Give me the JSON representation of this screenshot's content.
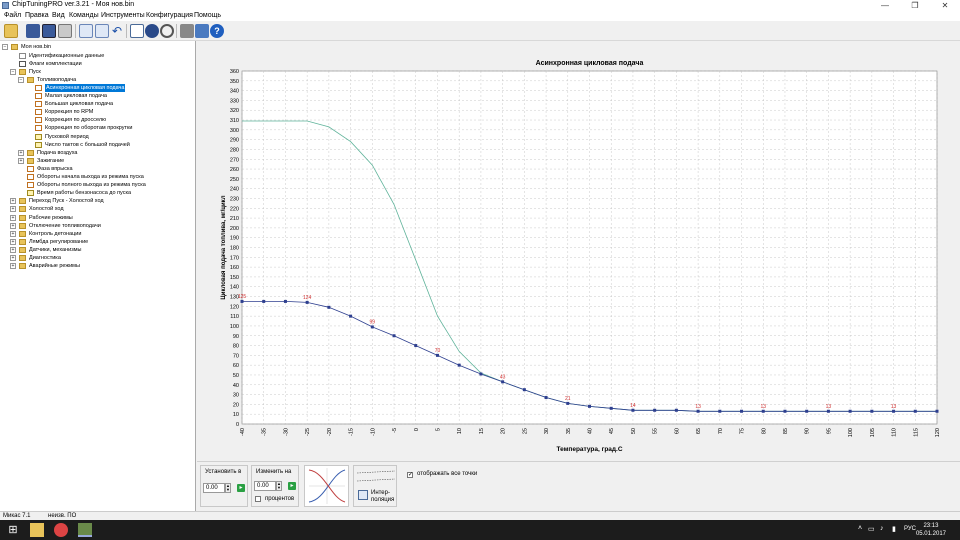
{
  "window": {
    "title": "ChipTuningPRO ver.3.21 - Моя нов.bin",
    "minimize": "—",
    "maximize": "❐",
    "close": "✕"
  },
  "menu": [
    "Файл",
    "Правка",
    "Вид",
    "Команды",
    "Инструменты",
    "Конфигурация",
    "Помощь"
  ],
  "toolbar_icons": [
    "open-folder-icon",
    "save-icon",
    "save-as-icon",
    "print-icon",
    "copy-icon",
    "paste-icon",
    "undo-icon",
    "export-icon",
    "info-icon",
    "find-icon",
    "connect-icon",
    "device-icon",
    "help-icon"
  ],
  "tree": {
    "root": "Моя нов.bin",
    "items": [
      {
        "label": "Идентификационные данные",
        "level": 1,
        "icon": "doc",
        "toggle": ""
      },
      {
        "label": "Флаги комплектации",
        "level": 1,
        "icon": "chk",
        "toggle": ""
      },
      {
        "label": "Пуск",
        "level": 1,
        "icon": "folder",
        "toggle": "−"
      },
      {
        "label": "Топливоподача",
        "level": 2,
        "icon": "folder",
        "toggle": "−"
      },
      {
        "label": "Асинхронная цикловая подача",
        "level": 3,
        "icon": "table",
        "toggle": "",
        "selected": true
      },
      {
        "label": "Малая цикловая подача",
        "level": 3,
        "icon": "table",
        "toggle": ""
      },
      {
        "label": "Большая цикловая подача",
        "level": 3,
        "icon": "table",
        "toggle": ""
      },
      {
        "label": "Коррекция по RPM",
        "level": 3,
        "icon": "table",
        "toggle": ""
      },
      {
        "label": "Коррекция по дросселю",
        "level": 3,
        "icon": "table",
        "toggle": ""
      },
      {
        "label": "Коррекция по оборотам прокрутки",
        "level": 3,
        "icon": "table",
        "toggle": ""
      },
      {
        "label": "Пусковой период",
        "level": 3,
        "icon": "val",
        "toggle": ""
      },
      {
        "label": "Число тактов с большой подачей",
        "level": 3,
        "icon": "val",
        "toggle": ""
      },
      {
        "label": "Подача воздуха",
        "level": 2,
        "icon": "folder",
        "toggle": "+"
      },
      {
        "label": "Зажигание",
        "level": 2,
        "icon": "folder",
        "toggle": "+"
      },
      {
        "label": "Фаза впрыска",
        "level": 2,
        "icon": "table",
        "toggle": ""
      },
      {
        "label": "Обороты начала выхода из режима пуска",
        "level": 2,
        "icon": "table",
        "toggle": ""
      },
      {
        "label": "Обороты полного выхода из режима пуска",
        "level": 2,
        "icon": "table",
        "toggle": ""
      },
      {
        "label": "Время работы бензонасоса до пуска",
        "level": 2,
        "icon": "val",
        "toggle": ""
      },
      {
        "label": "Переход Пуск - Холостой ход",
        "level": 1,
        "icon": "folder",
        "toggle": "+"
      },
      {
        "label": "Холостой ход",
        "level": 1,
        "icon": "folder",
        "toggle": "+"
      },
      {
        "label": "Рабочие режимы",
        "level": 1,
        "icon": "folder",
        "toggle": "+"
      },
      {
        "label": "Отключение топливоподачи",
        "level": 1,
        "icon": "folder",
        "toggle": "+"
      },
      {
        "label": "Контроль детонации",
        "level": 1,
        "icon": "folder",
        "toggle": "+"
      },
      {
        "label": "Лямбда регулирование",
        "level": 1,
        "icon": "folder",
        "toggle": "+"
      },
      {
        "label": "Датчики, механизмы",
        "level": 1,
        "icon": "folder",
        "toggle": "+"
      },
      {
        "label": "Диагностика",
        "level": 1,
        "icon": "folder",
        "toggle": "+"
      },
      {
        "label": "Аварийные режимы",
        "level": 1,
        "icon": "folder",
        "toggle": "+"
      }
    ]
  },
  "chart_data": {
    "type": "line",
    "title": "Асинхронная цикловая подача",
    "xlabel": "Температура, град.С",
    "ylabel": "Цикловая подача топлива, мг/цикл",
    "categories": [
      -40,
      -35,
      -30,
      -25,
      -20,
      -15,
      -10,
      -5,
      0,
      5,
      10,
      15,
      20,
      25,
      30,
      35,
      40,
      45,
      50,
      55,
      60,
      65,
      70,
      75,
      80,
      85,
      90,
      95,
      100,
      105,
      110,
      115,
      120
    ],
    "ylim": [
      0,
      360
    ],
    "ytick_step": 10,
    "grid": true,
    "series": [
      {
        "color": "#2e3f8f",
        "values": [
          125,
          125,
          125,
          124,
          119,
          110,
          99,
          90,
          80,
          70,
          60,
          51,
          43,
          35,
          27,
          21,
          18,
          16,
          14,
          14,
          14,
          13,
          13,
          13,
          13,
          13,
          13,
          13,
          13,
          13,
          13,
          13,
          13
        ]
      },
      {
        "color": "#5fb39a",
        "values": [
          309,
          309,
          309,
          309,
          303,
          288,
          264,
          224,
          167,
          110,
          74,
          52,
          43,
          35,
          27,
          21,
          18,
          16,
          14,
          14,
          14,
          13,
          13,
          13,
          13,
          13,
          13,
          13,
          13,
          13,
          13,
          13,
          13
        ]
      }
    ],
    "point_labels": [
      {
        "index": 0,
        "text": "125"
      },
      {
        "index": 3,
        "text": "124"
      },
      {
        "index": 6,
        "text": "99"
      },
      {
        "index": 9,
        "text": "70"
      },
      {
        "index": 12,
        "text": "43"
      },
      {
        "index": 15,
        "text": "21"
      },
      {
        "index": 18,
        "text": "14"
      },
      {
        "index": 21,
        "text": "13"
      },
      {
        "index": 24,
        "text": "13"
      },
      {
        "index": 27,
        "text": "13"
      },
      {
        "index": 30,
        "text": "13"
      }
    ],
    "label_color": "#d03030"
  },
  "bottom": {
    "set_label": "Установить в",
    "set_value": "0.00",
    "change_label": "Изменить на",
    "change_value": "0.00",
    "percent_label": "процентов",
    "percent_checked": false,
    "interp_label": "Интер-\nполяция",
    "show_all_label": "отображать все точки",
    "show_all_checked": true
  },
  "status": {
    "ecu": "Микас 7.1",
    "po": "неизв. ПО"
  },
  "taskbar": {
    "lang": "РУС",
    "time": "23:13",
    "date": "05.01.2017"
  }
}
